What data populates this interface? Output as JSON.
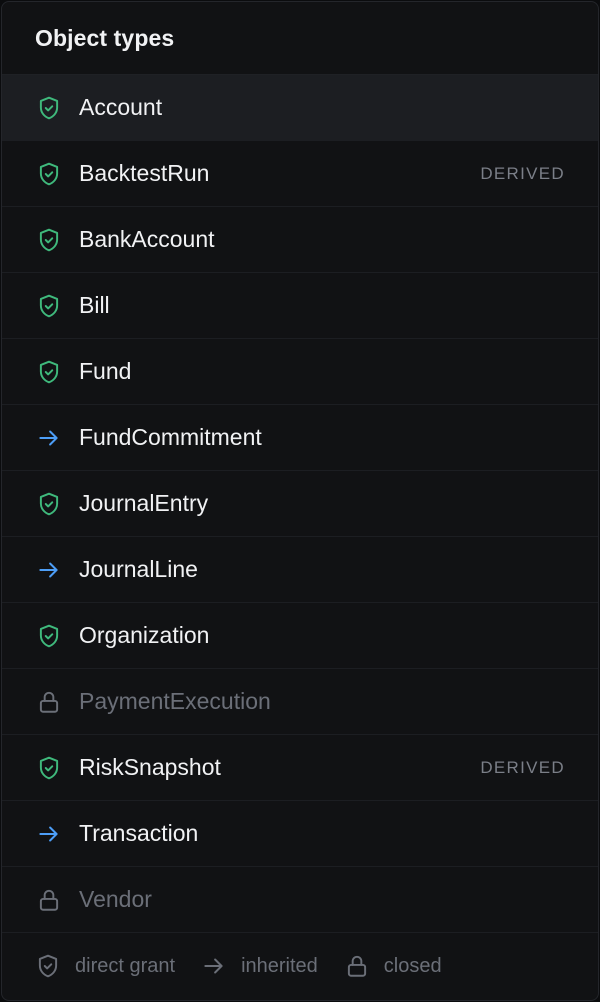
{
  "header": {
    "title": "Object types"
  },
  "colors": {
    "grant": "#3fb97c",
    "inherited": "#4d9ef7",
    "closed": "#6b6f78"
  },
  "items": [
    {
      "label": "Account",
      "status": "grant",
      "badge": "",
      "selected": true
    },
    {
      "label": "BacktestRun",
      "status": "grant",
      "badge": "DERIVED"
    },
    {
      "label": "BankAccount",
      "status": "grant",
      "badge": ""
    },
    {
      "label": "Bill",
      "status": "grant",
      "badge": ""
    },
    {
      "label": "Fund",
      "status": "grant",
      "badge": ""
    },
    {
      "label": "FundCommitment",
      "status": "inherited",
      "badge": ""
    },
    {
      "label": "JournalEntry",
      "status": "grant",
      "badge": ""
    },
    {
      "label": "JournalLine",
      "status": "inherited",
      "badge": ""
    },
    {
      "label": "Organization",
      "status": "grant",
      "badge": ""
    },
    {
      "label": "PaymentExecution",
      "status": "closed",
      "badge": ""
    },
    {
      "label": "RiskSnapshot",
      "status": "grant",
      "badge": "DERIVED"
    },
    {
      "label": "Transaction",
      "status": "inherited",
      "badge": ""
    },
    {
      "label": "Vendor",
      "status": "closed",
      "badge": ""
    }
  ],
  "legend": {
    "direct": "direct grant",
    "inherited": "inherited",
    "closed": "closed"
  }
}
